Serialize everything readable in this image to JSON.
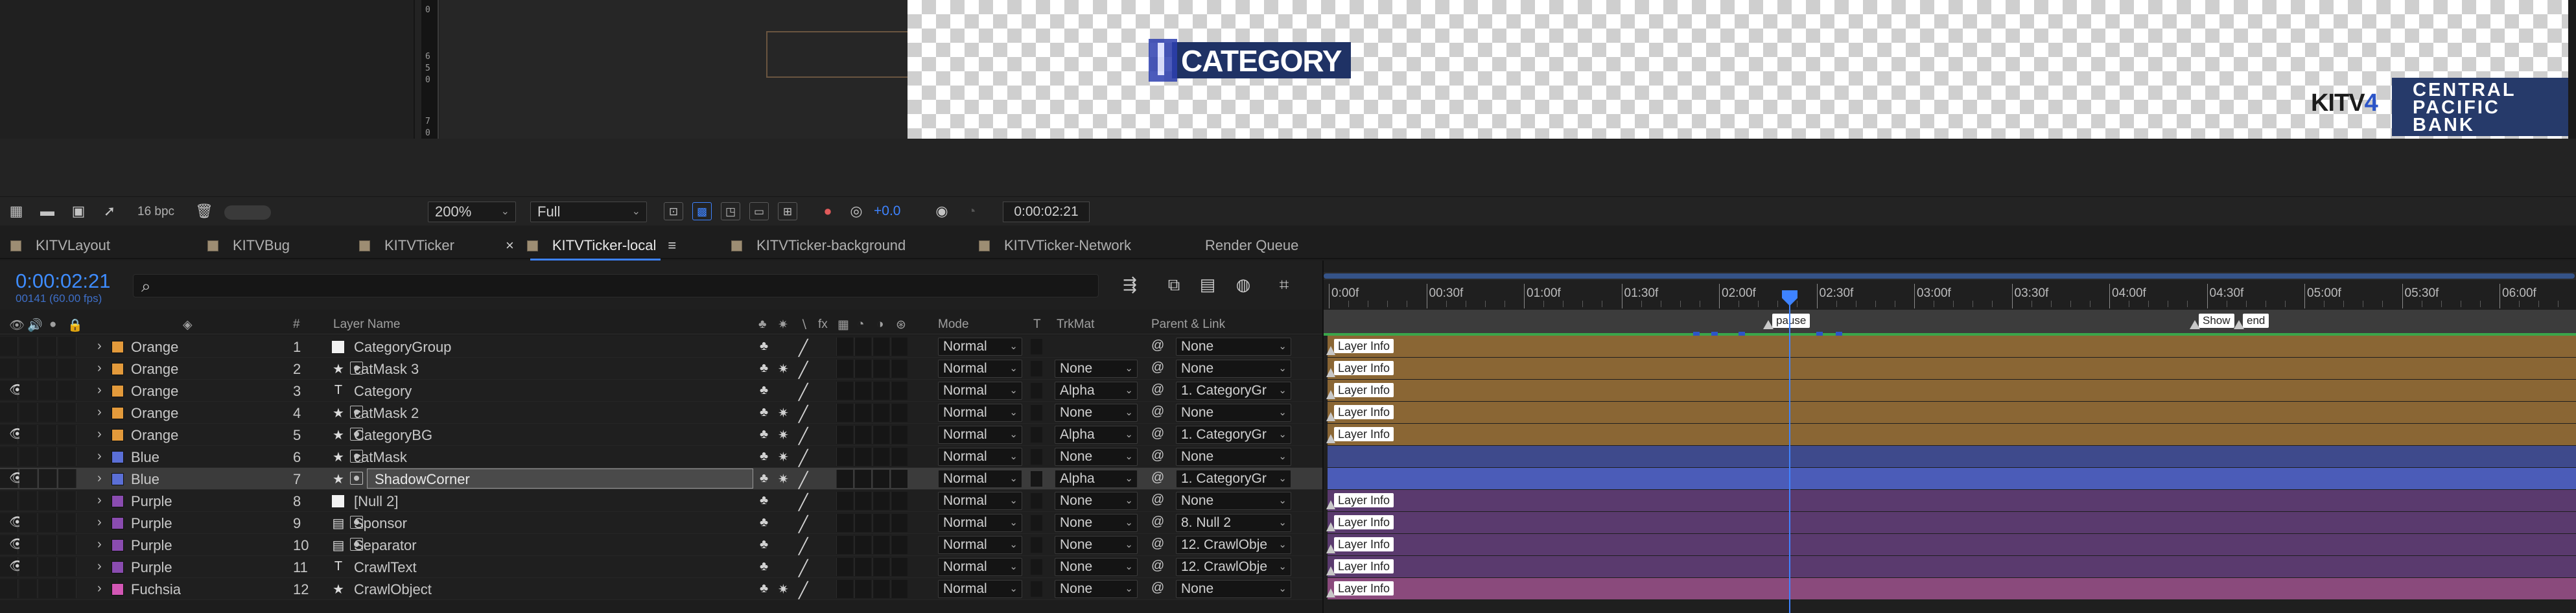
{
  "viewer": {
    "ruler_numbers": [
      "0",
      "6",
      "5",
      "0",
      "7",
      "0"
    ],
    "category_text": "CATEGORY",
    "kitv_logo": "KITV",
    "kitv_logo_digit": "4",
    "bank_logo": [
      "CENTRAL",
      "PACIFIC",
      "BANK"
    ]
  },
  "toolbar": {
    "bpc_label": "16 bpc",
    "zoom": "200%",
    "resolution": "Full",
    "exposure": "+0.0",
    "current_time": "0:00:02:21"
  },
  "tabs": [
    {
      "label": "KITVLayout",
      "active": false
    },
    {
      "label": "KITVBug",
      "active": false
    },
    {
      "label": "KITVTicker",
      "active": false
    },
    {
      "label": "KITVTicker-local",
      "active": true
    },
    {
      "label": "KITVTicker-background",
      "active": false
    },
    {
      "label": "KITVTicker-Network",
      "active": false
    },
    {
      "label": "Render Queue",
      "active": false
    }
  ],
  "timeline": {
    "timecode": "0:00:02:21",
    "frame_info": "00141 (60.00 fps)",
    "search_placeholder": ""
  },
  "layer_header": {
    "hash": "#",
    "layer_name": "Layer Name",
    "mode": "Mode",
    "t": "T",
    "trkmat": "TrkMat",
    "parent_link": "Parent & Link"
  },
  "layers": [
    {
      "visible": false,
      "label": "Orange",
      "color": "#e39a3b",
      "num": "1",
      "type": "solid",
      "name": "CategoryGroup",
      "mode": "Normal",
      "trkmat": "",
      "parent": "None",
      "bar_color": "#8a6634",
      "tag": "Layer Info"
    },
    {
      "visible": false,
      "label": "Orange",
      "color": "#e39a3b",
      "num": "2",
      "type": "shape",
      "name": "catMask 3",
      "mode": "Normal",
      "trkmat": "None",
      "parent": "None",
      "bar_color": "#8a6634",
      "tag": "Layer Info"
    },
    {
      "visible": true,
      "label": "Orange",
      "color": "#e39a3b",
      "num": "3",
      "type": "text",
      "name": "Category",
      "mode": "Normal",
      "trkmat": "Alpha",
      "parent": "1. CategoryGr",
      "bar_color": "#8a6634",
      "tag": "Layer Info"
    },
    {
      "visible": false,
      "label": "Orange",
      "color": "#e39a3b",
      "num": "4",
      "type": "shape",
      "name": "catMask 2",
      "mode": "Normal",
      "trkmat": "None",
      "parent": "None",
      "bar_color": "#8a6634",
      "tag": "Layer Info"
    },
    {
      "visible": true,
      "label": "Orange",
      "color": "#e39a3b",
      "num": "5",
      "type": "shape",
      "name": "CategoryBG",
      "mode": "Normal",
      "trkmat": "Alpha",
      "parent": "1. CategoryGr",
      "bar_color": "#8a6634",
      "tag": "Layer Info"
    },
    {
      "visible": false,
      "label": "Blue",
      "color": "#5b6fd6",
      "num": "6",
      "type": "shape",
      "name": "catMask",
      "mode": "Normal",
      "trkmat": "None",
      "parent": "None",
      "bar_color": "#3e4a8c",
      "tag": ""
    },
    {
      "visible": true,
      "label": "Blue",
      "color": "#5b6fd6",
      "num": "7",
      "type": "shape",
      "name": "ShadowCorner",
      "mode": "Normal",
      "trkmat": "Alpha",
      "parent": "1. CategoryGr",
      "bar_color": "#4b5cb8",
      "tag": "",
      "selected": true
    },
    {
      "visible": false,
      "label": "Purple",
      "color": "#8a4cb0",
      "num": "8",
      "type": "solid",
      "name": "[Null 2]",
      "mode": "Normal",
      "trkmat": "None",
      "parent": "None",
      "bar_color": "#5a3a6e",
      "tag": "Layer Info"
    },
    {
      "visible": true,
      "label": "Purple",
      "color": "#8a4cb0",
      "num": "9",
      "type": "file",
      "name": "Sponsor",
      "mode": "Normal",
      "trkmat": "None",
      "parent": "8. Null 2",
      "bar_color": "#5a3a6e",
      "tag": "Layer Info"
    },
    {
      "visible": true,
      "label": "Purple",
      "color": "#8a4cb0",
      "num": "10",
      "type": "file",
      "name": "Separator",
      "mode": "Normal",
      "trkmat": "None",
      "parent": "12. CrawlObje",
      "bar_color": "#5a3a6e",
      "tag": "Layer Info"
    },
    {
      "visible": true,
      "label": "Purple",
      "color": "#8a4cb0",
      "num": "11",
      "type": "text",
      "name": "CrawlText",
      "mode": "Normal",
      "trkmat": "None",
      "parent": "12. CrawlObje",
      "bar_color": "#5a3a6e",
      "tag": "Layer Info"
    },
    {
      "visible": false,
      "label": "Fuchsia",
      "color": "#d357b5",
      "num": "12",
      "type": "star",
      "name": "CrawlObject",
      "mode": "Normal",
      "trkmat": "None",
      "parent": "None",
      "bar_color": "#8a4a7c",
      "tag": "Layer Info"
    }
  ],
  "ruler": {
    "labels": [
      "0:00f",
      "00:30f",
      "01:00f",
      "01:30f",
      "02:00f",
      "02:30f",
      "03:00f",
      "03:30f",
      "04:00f",
      "04:30f",
      "05:00f",
      "05:30f",
      "06:00f"
    ]
  },
  "markers": [
    {
      "label": "pause"
    },
    {
      "label": "Show"
    },
    {
      "label": "end"
    }
  ],
  "colors": {
    "accent": "#3e83ff",
    "green_line": "#3aa64a"
  }
}
